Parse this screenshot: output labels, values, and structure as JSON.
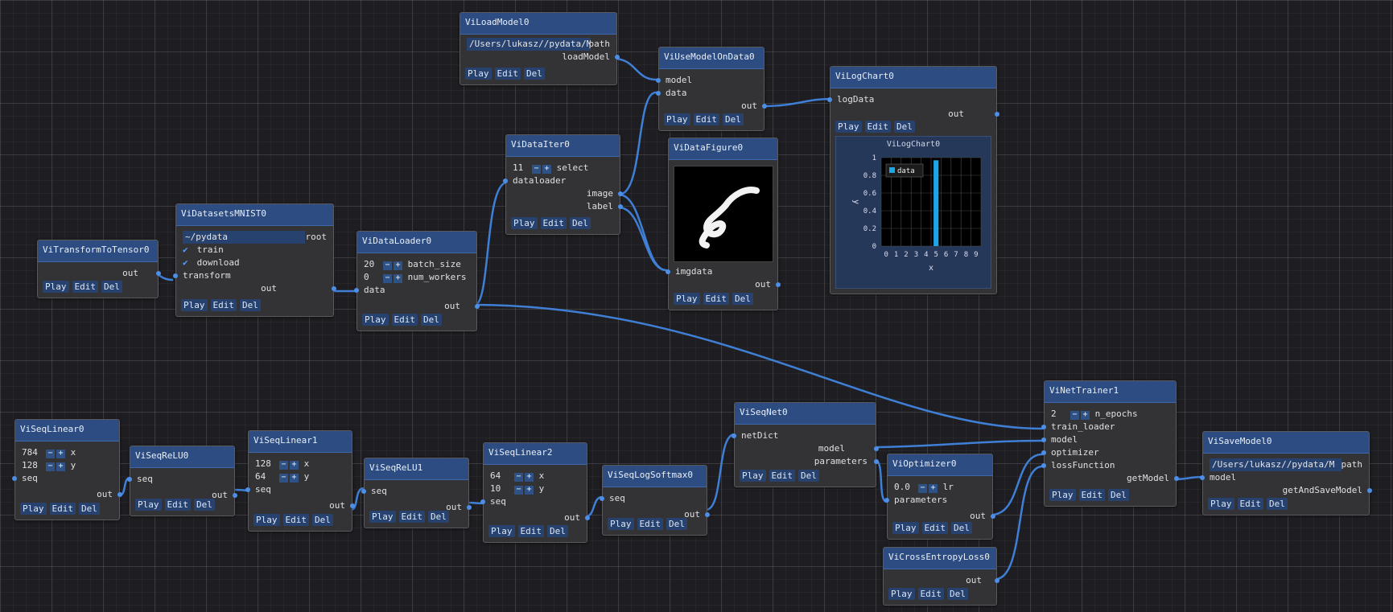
{
  "buttons": {
    "play": "Play",
    "edit": "Edit",
    "del": "Del"
  },
  "colors": {
    "wire": "#3f7fd6",
    "header": "#2d4d82",
    "pin": "#4d8fe6",
    "bar": "#1ca6e8"
  },
  "nodes": {
    "load_model": {
      "title": "ViLoadModel0",
      "path_value": "/Users/lukasz//pydata/M",
      "path_label": "path",
      "output": "loadModel"
    },
    "use_model": {
      "title": "ViUseModelOnData0",
      "in_model": "model",
      "in_data": "data",
      "out": "out"
    },
    "log_chart_node": {
      "title": "ViLogChart0",
      "in_log": "logData",
      "out": "out"
    },
    "data_iter": {
      "title": "ViDataIter0",
      "select_value": "11",
      "select_label": "select",
      "in_loader": "dataloader",
      "out_image": "image",
      "out_label": "label"
    },
    "data_figure": {
      "title": "ViDataFigure0",
      "in_img": "imgdata",
      "out": "out"
    },
    "mnist": {
      "title": "ViDatasetsMNIST0",
      "root_value": "~/pydata",
      "root_label": "root",
      "train": "train",
      "download": "download",
      "in_transform": "transform",
      "out": "out"
    },
    "to_tensor": {
      "title": "ViTransformToTensor0",
      "out": "out"
    },
    "data_loader": {
      "title": "ViDataLoader0",
      "batch_value": "20",
      "batch_label": "batch_size",
      "workers_value": "0",
      "workers_label": "num_workers",
      "in_data": "data",
      "out": "out"
    },
    "seq_linear0": {
      "title": "ViSeqLinear0",
      "x_value": "784",
      "x_label": "x",
      "y_value": "128",
      "y_label": "y",
      "in_seq": "seq",
      "out": "out"
    },
    "seq_relu0": {
      "title": "ViSeqReLU0",
      "in_seq": "seq",
      "out": "out"
    },
    "seq_linear1": {
      "title": "ViSeqLinear1",
      "x_value": "128",
      "x_label": "x",
      "y_value": "64",
      "y_label": "y",
      "in_seq": "seq",
      "out": "out"
    },
    "seq_relu1": {
      "title": "ViSeqReLU1",
      "in_seq": "seq",
      "out": "out"
    },
    "seq_linear2": {
      "title": "ViSeqLinear2",
      "x_value": "64",
      "x_label": "x",
      "y_value": "10",
      "y_label": "y",
      "in_seq": "seq",
      "out": "out"
    },
    "seq_logsoftmax": {
      "title": "ViSeqLogSoftmax0",
      "in_seq": "seq",
      "out": "out"
    },
    "seq_net": {
      "title": "ViSeqNet0",
      "in_dict": "netDict",
      "out_model": "model",
      "out_params": "parameters"
    },
    "optimizer": {
      "title": "ViOptimizer0",
      "lr_value": "0.0",
      "lr_label": "lr",
      "in_params": "parameters",
      "out": "out"
    },
    "ce_loss": {
      "title": "ViCrossEntropyLoss0",
      "out": "out"
    },
    "net_trainer": {
      "title": "ViNetTrainer1",
      "epochs_value": "2",
      "epochs_label": "n_epochs",
      "in_train": "train_loader",
      "in_model": "model",
      "in_opt": "optimizer",
      "in_loss": "lossFunction",
      "out": "getModel"
    },
    "save_model": {
      "title": "ViSaveModel0",
      "path_value": "/Users/lukasz//pydata/M",
      "path_label": "path",
      "in_model": "model",
      "out": "getAndSaveModel"
    }
  },
  "chart_data": {
    "type": "bar",
    "title": "ViLogChart0",
    "xlabel": "x",
    "ylabel": "y",
    "categories": [
      "0",
      "1",
      "2",
      "3",
      "4",
      "5",
      "6",
      "7",
      "8",
      "9"
    ],
    "series": [
      {
        "name": "data",
        "values": [
          0,
          0,
          0,
          0,
          0,
          0.97,
          0,
          0,
          0,
          0
        ]
      }
    ],
    "ylim": [
      0,
      1
    ],
    "yticks": [
      "0",
      "0.2",
      "0.4",
      "0.6",
      "0.8",
      "1"
    ],
    "legend": "top-left",
    "grid": true
  }
}
